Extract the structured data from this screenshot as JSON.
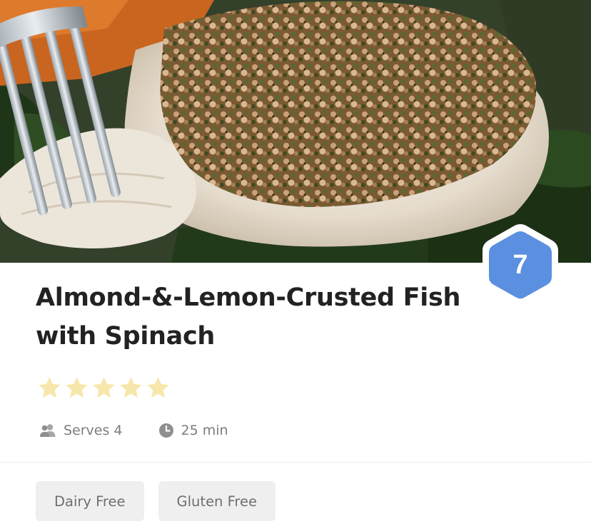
{
  "recipe": {
    "title": "Almond-&-Lemon-Crusted Fish with Spinach",
    "image_icon": "fish-dish-photo",
    "badge": {
      "value": "7",
      "color": "#5b8fe0",
      "icon": "hexagon-badge"
    },
    "rating": {
      "stars": 5,
      "max": 5,
      "star_color": "#f7e7ab",
      "icon": "star-icon"
    },
    "serves": {
      "icon": "people-icon",
      "label": "Serves 4"
    },
    "time": {
      "icon": "clock-icon",
      "label": "25 min"
    },
    "tags": [
      {
        "label": "Dairy Free"
      },
      {
        "label": "Gluten Free"
      }
    ]
  }
}
